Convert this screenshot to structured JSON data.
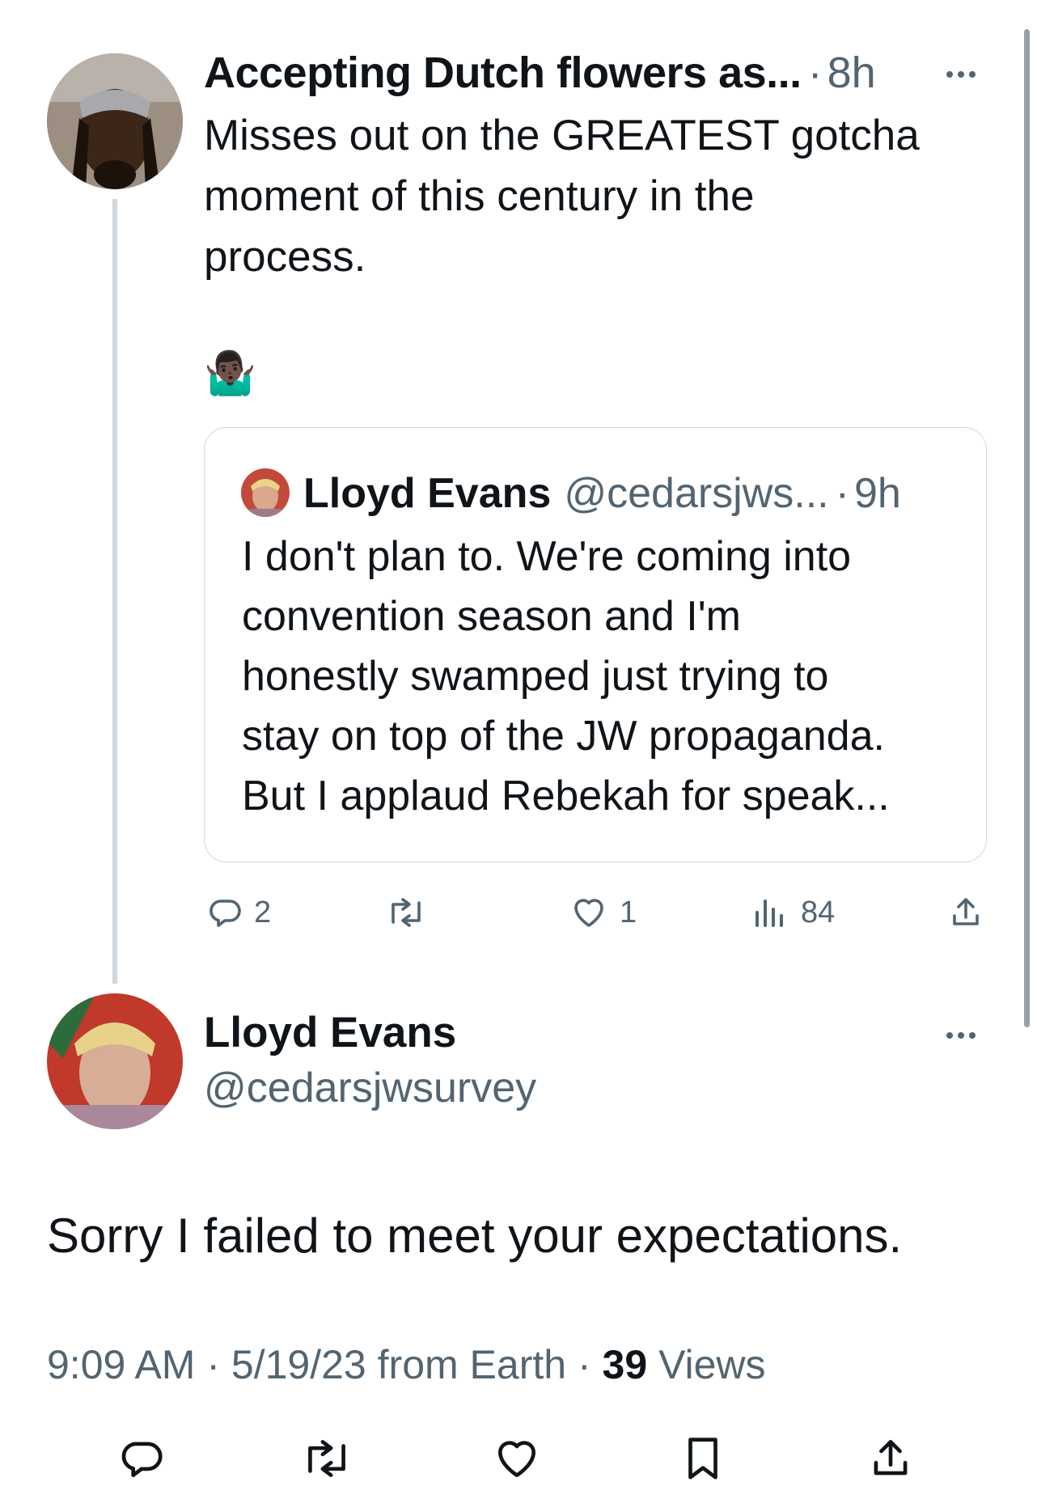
{
  "parent_tweet": {
    "author_name": "Accepting Dutch flowers as...",
    "separator": "·",
    "time": "8h",
    "body_lines": [
      "Misses out on the GREATEST gotcha",
      "moment of this century in the",
      "process."
    ],
    "emoji": "🤷🏿‍♂️",
    "quoted": {
      "author_name": "Lloyd Evans",
      "handle": "@cedarsjws...",
      "separator": "·",
      "time": "9h",
      "body_lines": [
        "I don't plan to. We're coming into",
        "convention season and I'm",
        "honestly swamped just trying to",
        "stay on top of the JW propaganda.",
        "But I applaud Rebekah for speak..."
      ]
    },
    "actions": {
      "replies": "2",
      "likes": "1",
      "views": "84"
    }
  },
  "main_tweet": {
    "author_name": "Lloyd Evans",
    "handle": "@cedarsjwsurvey",
    "body": "Sorry I failed to meet your expectations.",
    "meta": {
      "time": "9:09 AM",
      "sep1": "·",
      "date": "5/19/23",
      "source": "from Earth",
      "sep2": "·",
      "views_count": "39",
      "views_label": "Views"
    }
  },
  "icons": [
    "reply-icon",
    "retweet-icon",
    "like-icon",
    "views-icon",
    "share-icon",
    "bookmark-icon",
    "more-icon"
  ],
  "colors": {
    "text": "#0f1419",
    "muted": "#536471",
    "border": "#cfd9de",
    "background": "#ffffff"
  }
}
